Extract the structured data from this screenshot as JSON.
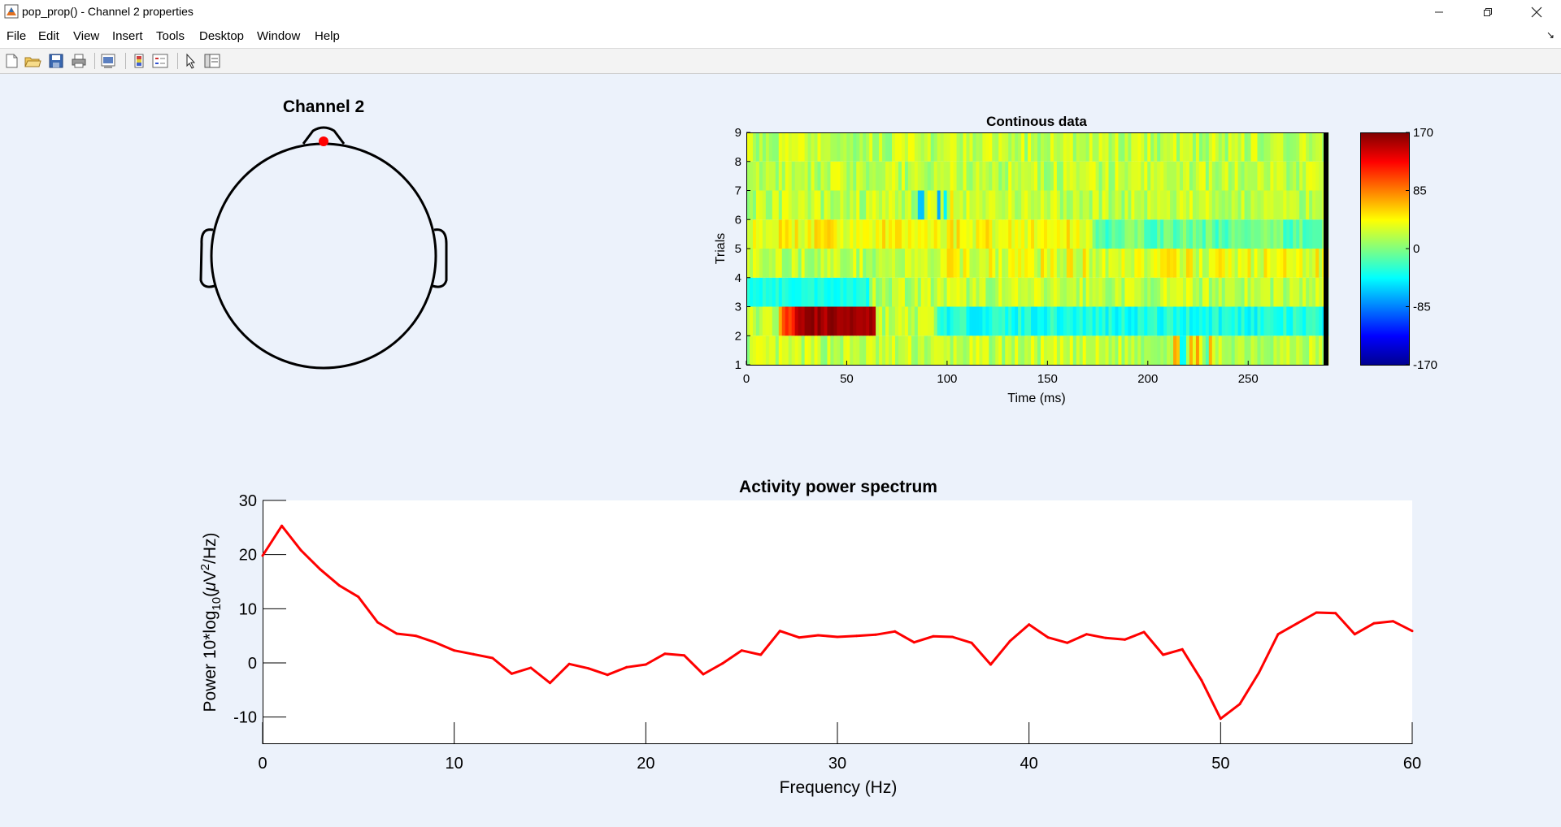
{
  "window": {
    "title": "pop_prop() - Channel 2 properties",
    "controls": [
      "minimize",
      "restore",
      "close"
    ]
  },
  "menu": [
    "File",
    "Edit",
    "View",
    "Insert",
    "Tools",
    "Desktop",
    "Window",
    "Help"
  ],
  "toolbar_icons": [
    "new-figure-icon",
    "open-file-icon",
    "save-icon",
    "print-icon",
    "print-preview-icon",
    "colorbar-icon",
    "legend-icon",
    "select-pointer-icon",
    "property-editor-icon"
  ],
  "colors": {
    "background": "#ecf2fb",
    "electrode": "#ff0000",
    "spectrum_line": "#ff0000"
  },
  "topo": {
    "title": "Channel 2"
  },
  "erpimage": {
    "title": "Continous data",
    "xlabel": "Time (ms)",
    "ylabel": "Trials",
    "xticks": [
      0,
      50,
      100,
      150,
      200,
      250
    ],
    "yticks": [
      1,
      2,
      3,
      4,
      5,
      6,
      7,
      8,
      9
    ],
    "xlim": [
      0,
      290
    ],
    "ylim": [
      1,
      9
    ],
    "colorbar": {
      "ticks": [
        170,
        85,
        0,
        -85,
        -170
      ],
      "range": [
        -170,
        170
      ],
      "colormap": "jet"
    }
  },
  "chart_data": {
    "type": "line",
    "title": "Activity power spectrum",
    "xlabel": "Frequency (Hz)",
    "ylabel_parts": {
      "a": "Power 10*log",
      "sub": "10",
      "b": "(",
      "mu": "μ",
      "c": "V",
      "sup": "2",
      "d": "/Hz)"
    },
    "xlim": [
      0,
      60
    ],
    "ylim": [
      -15,
      30
    ],
    "xticks": [
      0,
      10,
      20,
      30,
      40,
      50,
      60
    ],
    "yticks": [
      30,
      20,
      10,
      0,
      -10
    ],
    "grid": false,
    "series": [
      {
        "color": "#ff0000",
        "x": [
          0,
          1,
          2,
          3,
          4,
          5,
          6,
          7,
          8,
          9,
          10,
          11,
          12,
          13,
          14,
          15,
          16,
          17,
          18,
          19,
          20,
          21,
          22,
          23,
          24,
          25,
          26,
          27,
          28,
          29,
          30,
          31,
          32,
          33,
          34,
          35,
          36,
          37,
          38,
          39,
          40,
          41,
          42,
          43,
          44,
          45,
          46,
          47,
          48,
          49,
          50,
          51,
          52,
          53,
          54,
          55,
          56,
          57,
          58,
          59,
          60
        ],
        "y": [
          19.8,
          25.3,
          20.8,
          17.3,
          14.3,
          12.2,
          7.5,
          5.4,
          5.0,
          3.8,
          2.3,
          1.6,
          0.9,
          -2.0,
          -0.9,
          -3.7,
          -0.2,
          -1.0,
          -2.2,
          -0.8,
          -0.3,
          1.7,
          1.4,
          -2.1,
          -0.1,
          2.3,
          1.5,
          5.9,
          4.7,
          5.1,
          4.8,
          5.0,
          5.2,
          5.8,
          3.8,
          4.9,
          4.8,
          3.7,
          -0.3,
          4.0,
          7.1,
          4.7,
          3.7,
          5.3,
          4.6,
          4.3,
          5.7,
          1.5,
          2.5,
          -3.2,
          -10.3,
          -7.6,
          -1.8,
          5.3,
          7.3,
          9.3,
          9.2,
          5.3,
          7.3,
          7.7,
          5.9
        ]
      }
    ]
  }
}
